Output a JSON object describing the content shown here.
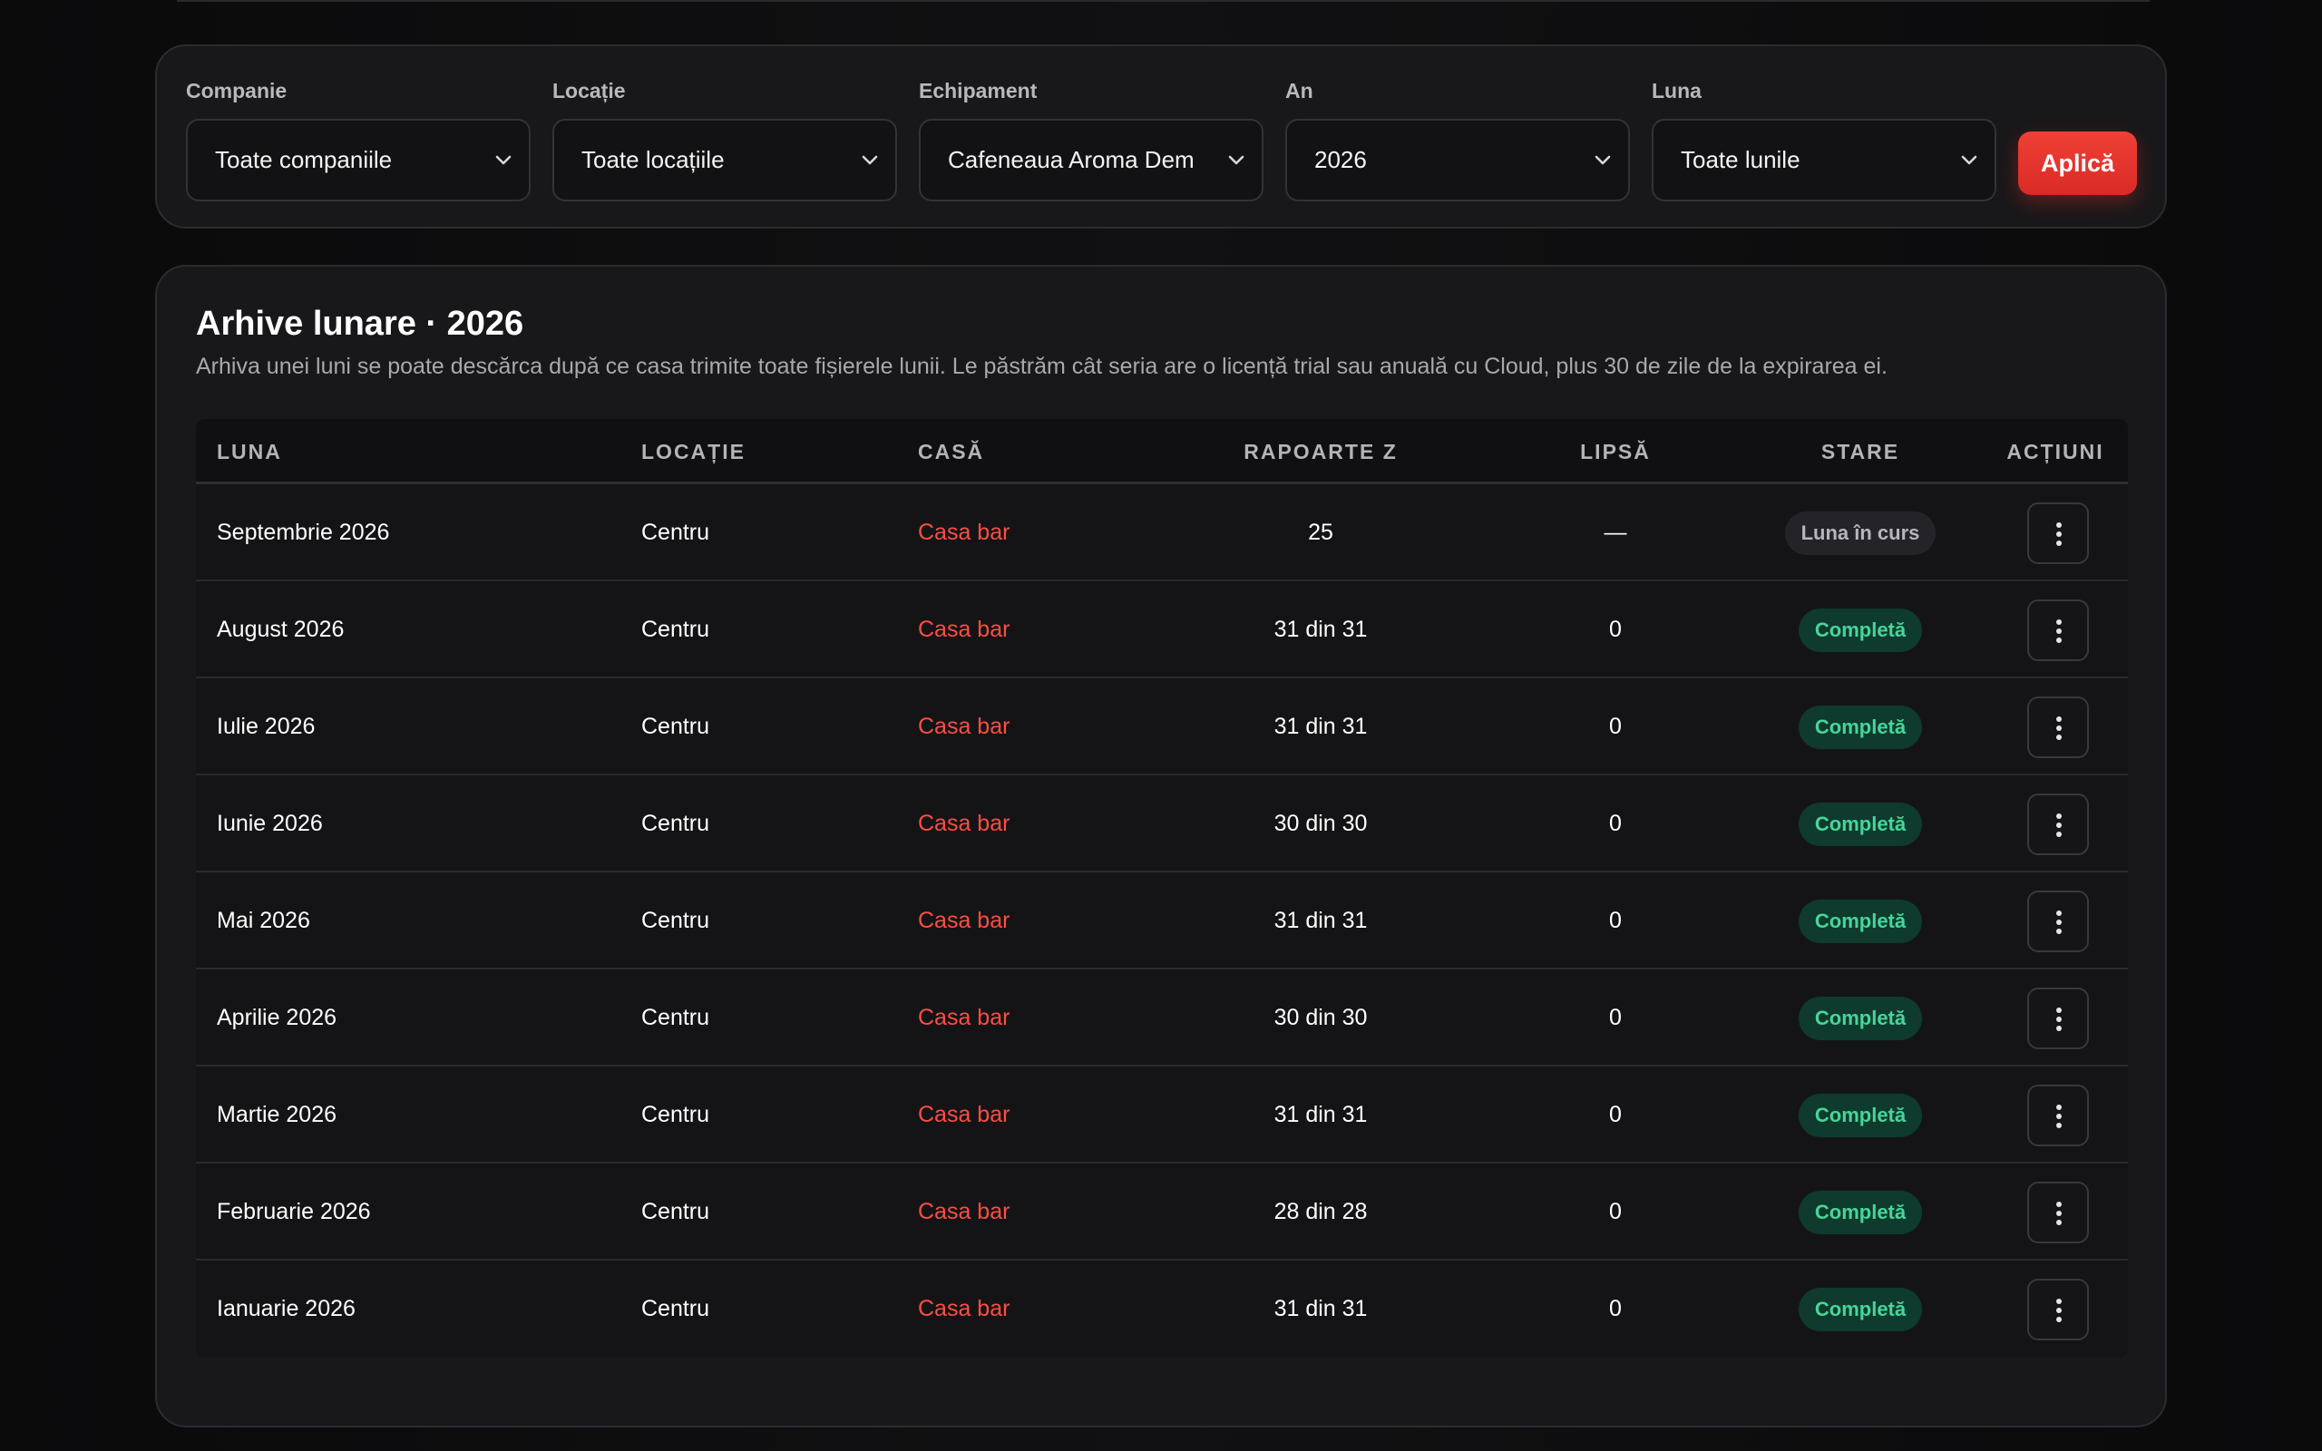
{
  "filters": {
    "company": {
      "label": "Companie",
      "value": "Toate companiile"
    },
    "location": {
      "label": "Locație",
      "value": "Toate locațiile"
    },
    "equipment": {
      "label": "Echipament",
      "value": "Cafeneaua Aroma Dem"
    },
    "year": {
      "label": "An",
      "value": "2026"
    },
    "month": {
      "label": "Luna",
      "value": "Toate lunile"
    },
    "apply_label": "Aplică"
  },
  "archive": {
    "title": "Arhive lunare · 2026",
    "description": "Arhiva unei luni se poate descărca după ce casa trimite toate fișierele lunii. Le păstrăm cât seria are o licență trial sau anuală cu Cloud, plus 30 de zile de la expirarea ei.",
    "columns": {
      "luna": "LUNA",
      "locatie": "LOCAȚIE",
      "casa": "CASĂ",
      "rapoarte": "RAPOARTE Z",
      "lipsa": "LIPSĂ",
      "stare": "STARE",
      "actiuni": "ACȚIUNI"
    },
    "rows": [
      {
        "luna": "Septembrie 2026",
        "locatie": "Centru",
        "casa": "Casa bar",
        "rapoarte": "25",
        "lipsa": "—",
        "stare": "Luna în curs"
      },
      {
        "luna": "August 2026",
        "locatie": "Centru",
        "casa": "Casa bar",
        "rapoarte": "31 din 31",
        "lipsa": "0",
        "stare": "Completă"
      },
      {
        "luna": "Iulie 2026",
        "locatie": "Centru",
        "casa": "Casa bar",
        "rapoarte": "31 din 31",
        "lipsa": "0",
        "stare": "Completă"
      },
      {
        "luna": "Iunie 2026",
        "locatie": "Centru",
        "casa": "Casa bar",
        "rapoarte": "30 din 30",
        "lipsa": "0",
        "stare": "Completă"
      },
      {
        "luna": "Mai 2026",
        "locatie": "Centru",
        "casa": "Casa bar",
        "rapoarte": "31 din 31",
        "lipsa": "0",
        "stare": "Completă"
      },
      {
        "luna": "Aprilie 2026",
        "locatie": "Centru",
        "casa": "Casa bar",
        "rapoarte": "30 din 30",
        "lipsa": "0",
        "stare": "Completă"
      },
      {
        "luna": "Martie 2026",
        "locatie": "Centru",
        "casa": "Casa bar",
        "rapoarte": "31 din 31",
        "lipsa": "0",
        "stare": "Completă"
      },
      {
        "luna": "Februarie 2026",
        "locatie": "Centru",
        "casa": "Casa bar",
        "rapoarte": "28 din 28",
        "lipsa": "0",
        "stare": "Completă"
      },
      {
        "luna": "Ianuarie 2026",
        "locatie": "Centru",
        "casa": "Casa bar",
        "rapoarte": "31 din 31",
        "lipsa": "0",
        "stare": "Completă"
      }
    ]
  },
  "colors": {
    "accent": "#e8352e",
    "link": "#ff4d43",
    "complete_text": "#46d69a",
    "complete_bg": "#0f3a2e"
  },
  "icons": {
    "select": "chevron-down-icon",
    "row_action": "more-vertical-icon"
  }
}
